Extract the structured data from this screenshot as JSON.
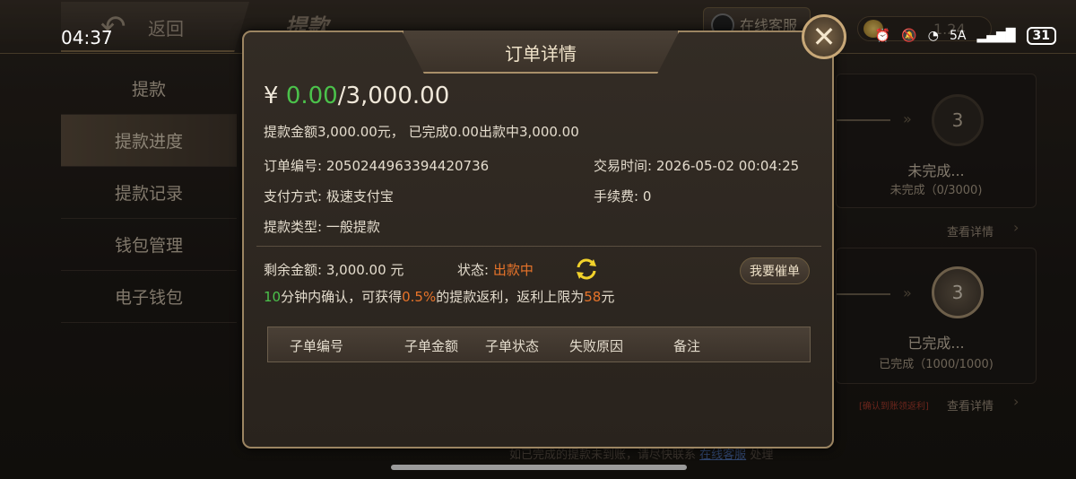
{
  "status_bar": {
    "time": "04:37",
    "network": "5A",
    "battery": "31"
  },
  "header": {
    "back_label": "返回",
    "page_title": "提款",
    "service_label": "在线客服",
    "coin_value": "1.24"
  },
  "left_nav": {
    "items": [
      {
        "label": "提款"
      },
      {
        "label": "提款进度",
        "active": true
      },
      {
        "label": "提款记录"
      },
      {
        "label": "钱包管理"
      },
      {
        "label": "电子钱包"
      }
    ]
  },
  "progress_cards": [
    {
      "step": "3",
      "status": "未完成...",
      "sub": "未完成（0/3000)",
      "detail_label": "查看详情"
    },
    {
      "step": "3",
      "status": "已完成...",
      "sub": "已完成（1000/1000)",
      "detail_label": "查看详情",
      "confirm_tip": "[确认到账领返利]"
    }
  ],
  "bottom_tip": {
    "text": "如已完成的提款未到账，请尽快联系",
    "link": "在线客服",
    "suffix": "处理"
  },
  "modal": {
    "title": "订单详情",
    "currency": "¥",
    "done_amount": "0.00",
    "total_amount": "/3,000.00",
    "summary": "提款金额3,000.00元， 已完成0.00出款中3,000.00",
    "order_no_label": "订单编号:",
    "order_no": "2050244963394420736",
    "trade_time_label": "交易时间:",
    "trade_time": "2026-05-02 00:04:25",
    "pay_method_label": "支付方式:",
    "pay_method": "极速支付宝",
    "fee_label": "手续费:",
    "fee": "0",
    "withdraw_type_label": "提款类型:",
    "withdraw_type": "一般提款",
    "remaining_label": "剩余金额:",
    "remaining": "3,000.00 元",
    "status_label": "状态:",
    "status": "出款中",
    "urge_label": "我要催单",
    "tip": {
      "minutes": "10",
      "part1": "分钟内确认，可获得",
      "rate": "0.5%",
      "part2": "的提款返利，返利上限为",
      "cap": "58",
      "part3": "元"
    },
    "table_headers": [
      "子单编号",
      "子单金额",
      "子单状态",
      "失败原因",
      "备注"
    ],
    "close_icon": "close-icon",
    "refresh_icon": "refresh-icon"
  },
  "colors": {
    "accent_green": "#4bc24b",
    "accent_orange": "#e8742a",
    "gold_border": "#9c8562"
  }
}
